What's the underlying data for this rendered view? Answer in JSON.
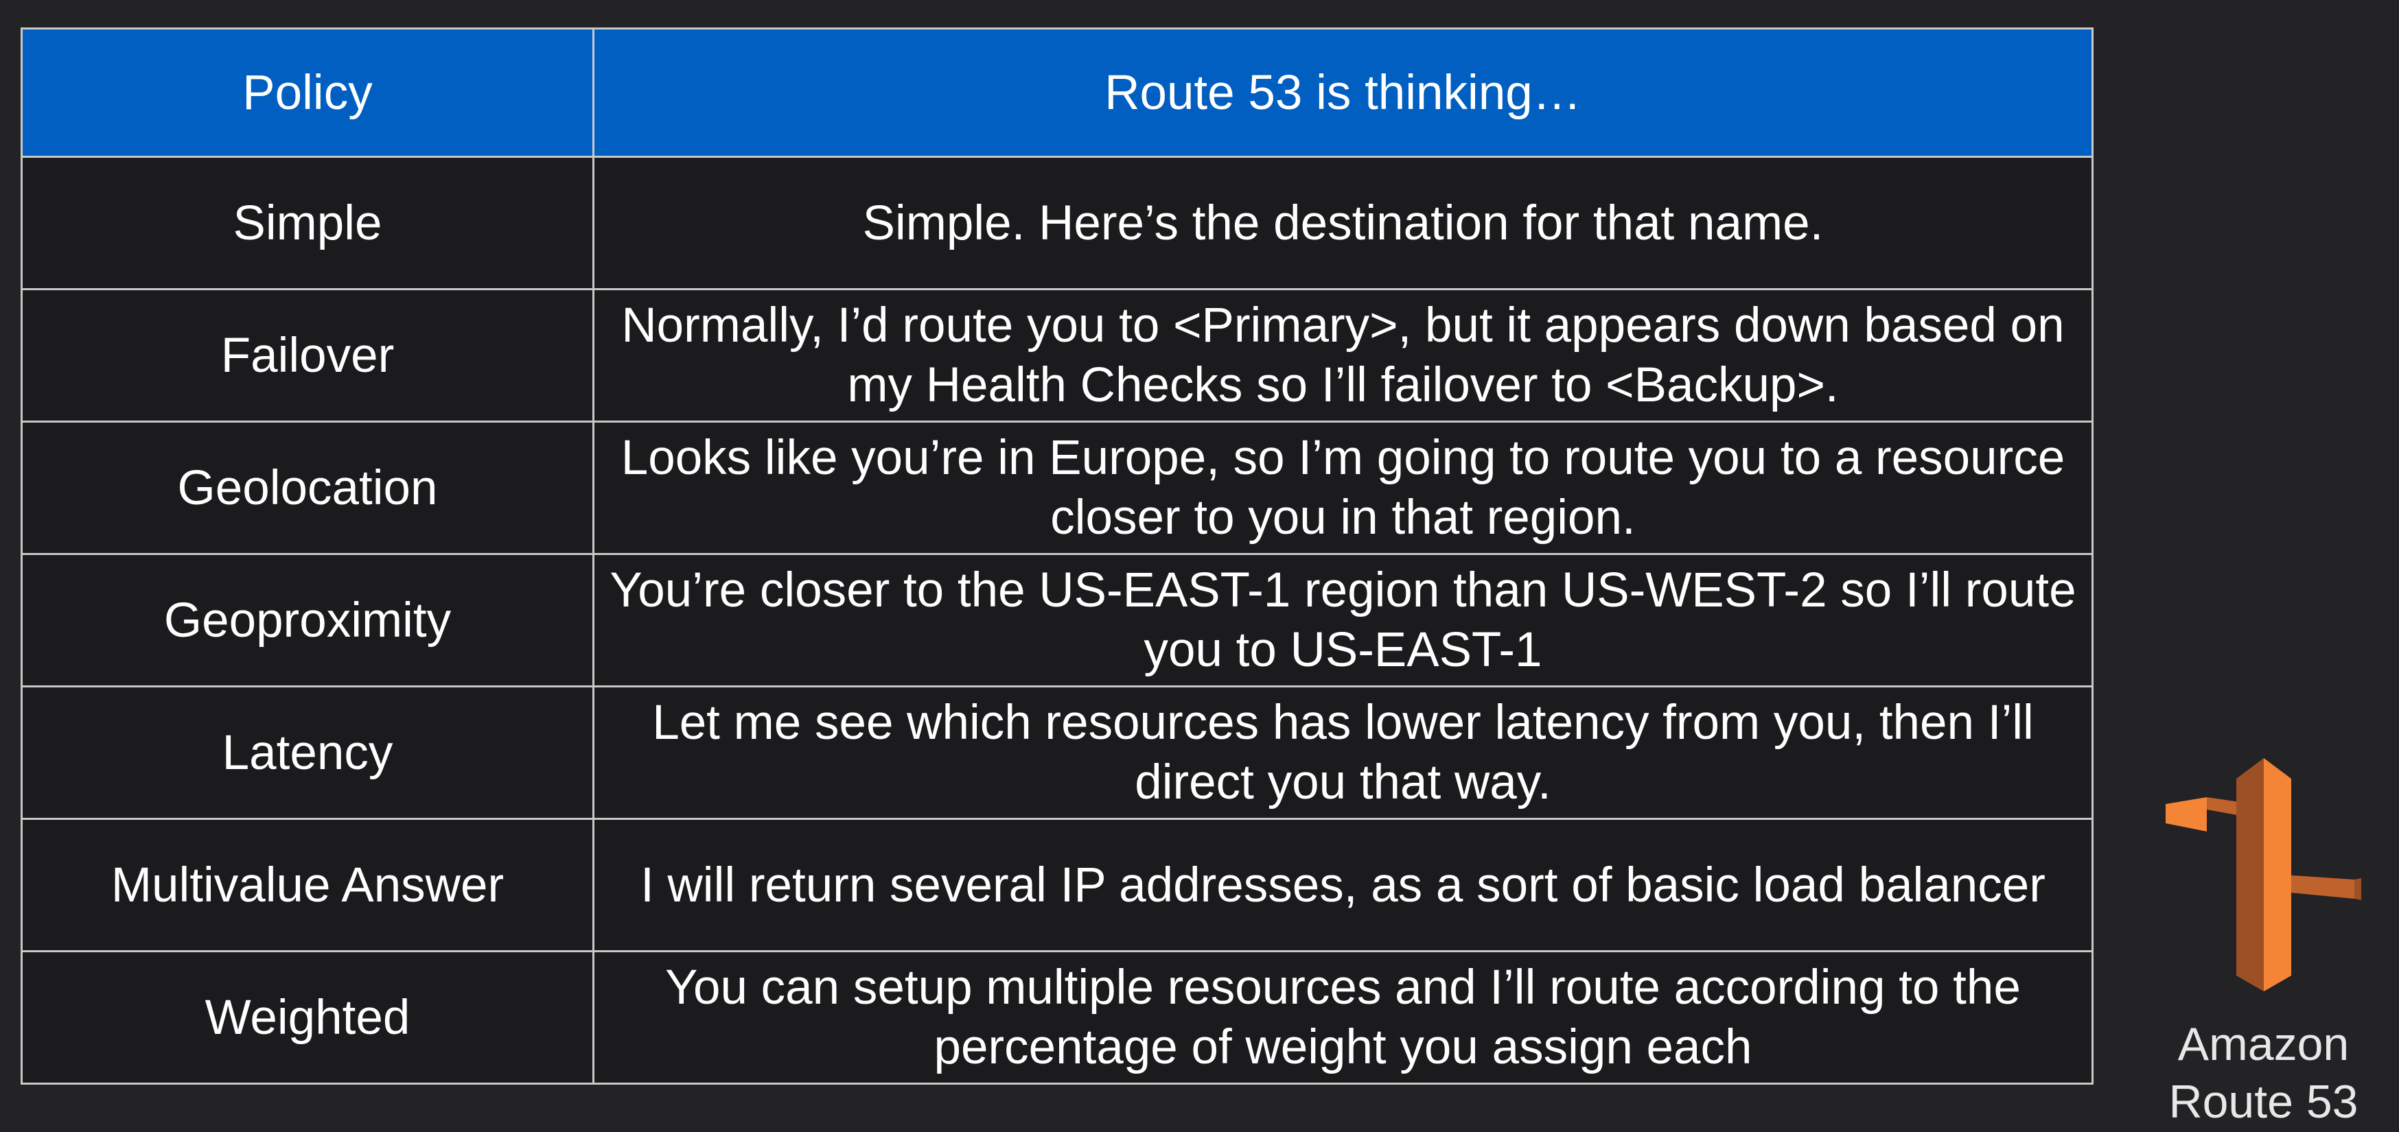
{
  "table": {
    "headers": {
      "policy": "Policy",
      "thought": "Route 53 is thinking…"
    },
    "rows": [
      {
        "policy": "Simple",
        "thought": "Simple.  Here’s the destination for that name."
      },
      {
        "policy": "Failover",
        "thought": "Normally, I’d route you to <Primary>, but it appears down based on my Health Checks so I’ll failover to <Backup>."
      },
      {
        "policy": "Geolocation",
        "thought": "Looks like you’re in Europe, so I’m going to route you to a resource closer to you in that region."
      },
      {
        "policy": "Geoproximity",
        "thought": "You’re closer to the US-EAST-1 region than US-WEST-2 so I’ll route you to US-EAST-1"
      },
      {
        "policy": "Latency",
        "thought": "Let me see which resources has lower latency from you, then I’ll direct you that way."
      },
      {
        "policy": "Multivalue Answer",
        "thought": "I will return several IP addresses, as a sort of basic load balancer"
      },
      {
        "policy": "Weighted",
        "thought": "You can setup multiple resources and I’ll route according to the percentage of weight you assign each"
      }
    ]
  },
  "logo": {
    "icon": "aws-route53-icon",
    "caption_line1": "Amazon",
    "caption_line2": "Route 53",
    "colors": {
      "light": "#f58536",
      "dark": "#9d5025"
    }
  },
  "colors": {
    "background": "#232225",
    "header": "#005fc0",
    "cell": "#1b1a1c",
    "border": "#c9c9c9"
  }
}
